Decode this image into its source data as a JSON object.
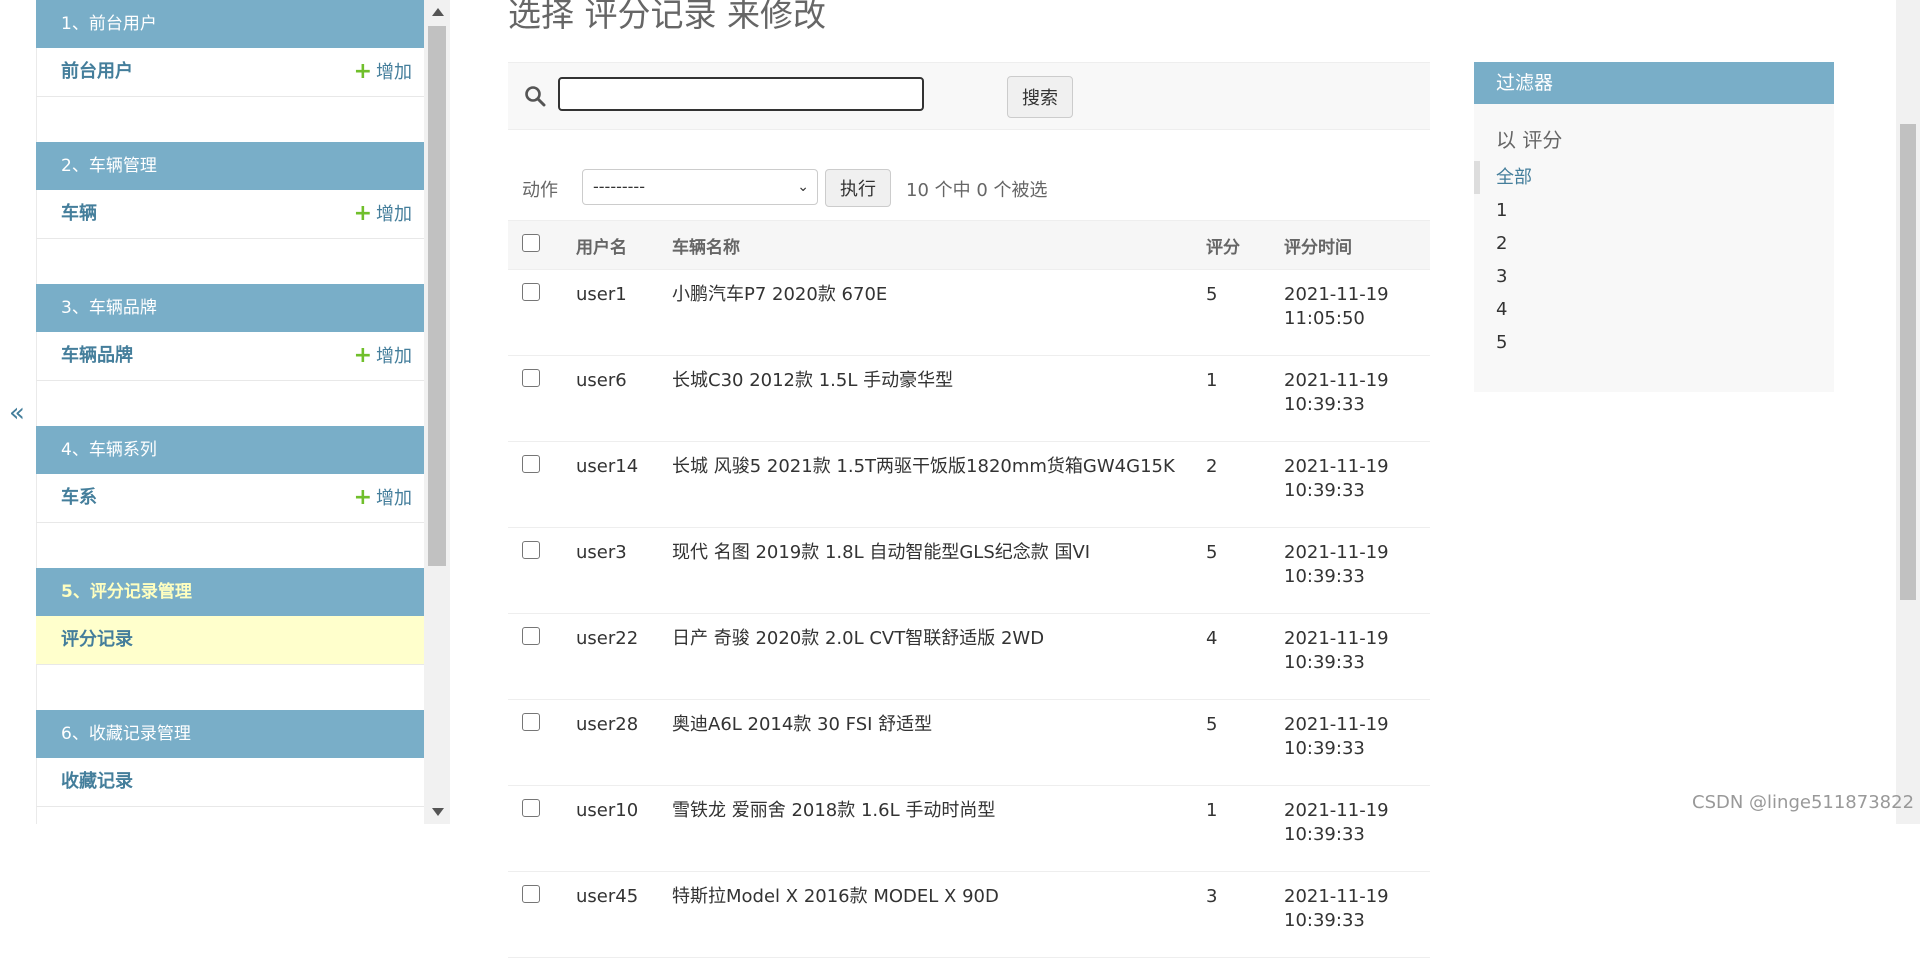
{
  "sidebar": {
    "collapse_label": "«",
    "add_label": "增加",
    "modules": [
      {
        "caption": "1、前台用户",
        "models": [
          {
            "name": "前台用户",
            "has_add": true
          }
        ]
      },
      {
        "caption": "2、车辆管理",
        "models": [
          {
            "name": "车辆",
            "has_add": true
          }
        ]
      },
      {
        "caption": "3、车辆品牌",
        "models": [
          {
            "name": "车辆品牌",
            "has_add": true
          }
        ]
      },
      {
        "caption": "4、车辆系列",
        "models": [
          {
            "name": "车系",
            "has_add": true
          }
        ]
      },
      {
        "caption": "5、评分记录管理",
        "active": true,
        "models": [
          {
            "name": "评分记录",
            "selected": true
          }
        ]
      },
      {
        "caption": "6、收藏记录管理",
        "models": [
          {
            "name": "收藏记录"
          }
        ]
      }
    ]
  },
  "page": {
    "title": "选择 评分记录 来修改"
  },
  "search": {
    "value": "",
    "button": "搜索"
  },
  "actions": {
    "label": "动作",
    "selected": "---------",
    "go": "执行",
    "counter": "10 个中 0 个被选"
  },
  "table": {
    "headers": [
      "用户名",
      "车辆名称",
      "评分",
      "评分时间"
    ],
    "rows": [
      {
        "user": "user1",
        "car": "小鹏汽车P7 2020款 670E",
        "score": "5",
        "date": "2021-11-19",
        "time": "11:05:50"
      },
      {
        "user": "user6",
        "car": "长城C30 2012款 1.5L 手动豪华型",
        "score": "1",
        "date": "2021-11-19",
        "time": "10:39:33"
      },
      {
        "user": "user14",
        "car": "长城 风骏5 2021款 1.5T两驱干饭版1820mm货箱GW4G15K",
        "score": "2",
        "date": "2021-11-19",
        "time": "10:39:33"
      },
      {
        "user": "user3",
        "car": "现代 名图 2019款 1.8L 自动智能型GLS纪念款 国VI",
        "score": "5",
        "date": "2021-11-19",
        "time": "10:39:33"
      },
      {
        "user": "user22",
        "car": "日产 奇骏 2020款 2.0L CVT智联舒适版 2WD",
        "score": "4",
        "date": "2021-11-19",
        "time": "10:39:33"
      },
      {
        "user": "user28",
        "car": "奥迪A6L 2014款 30 FSI 舒适型",
        "score": "5",
        "date": "2021-11-19",
        "time": "10:39:33"
      },
      {
        "user": "user10",
        "car": "雪铁龙 爱丽舍 2018款 1.6L 手动时尚型",
        "score": "1",
        "date": "2021-11-19",
        "time": "10:39:33"
      },
      {
        "user": "user45",
        "car": "特斯拉Model X 2016款 MODEL X 90D",
        "score": "3",
        "date": "2021-11-19",
        "time": "10:39:33"
      }
    ]
  },
  "filter": {
    "title": "过滤器",
    "subtitle": "以 评分",
    "options": [
      "全部",
      "1",
      "2",
      "3",
      "4",
      "5"
    ],
    "selected_index": 0
  },
  "watermark": "CSDN @linge511873822"
}
